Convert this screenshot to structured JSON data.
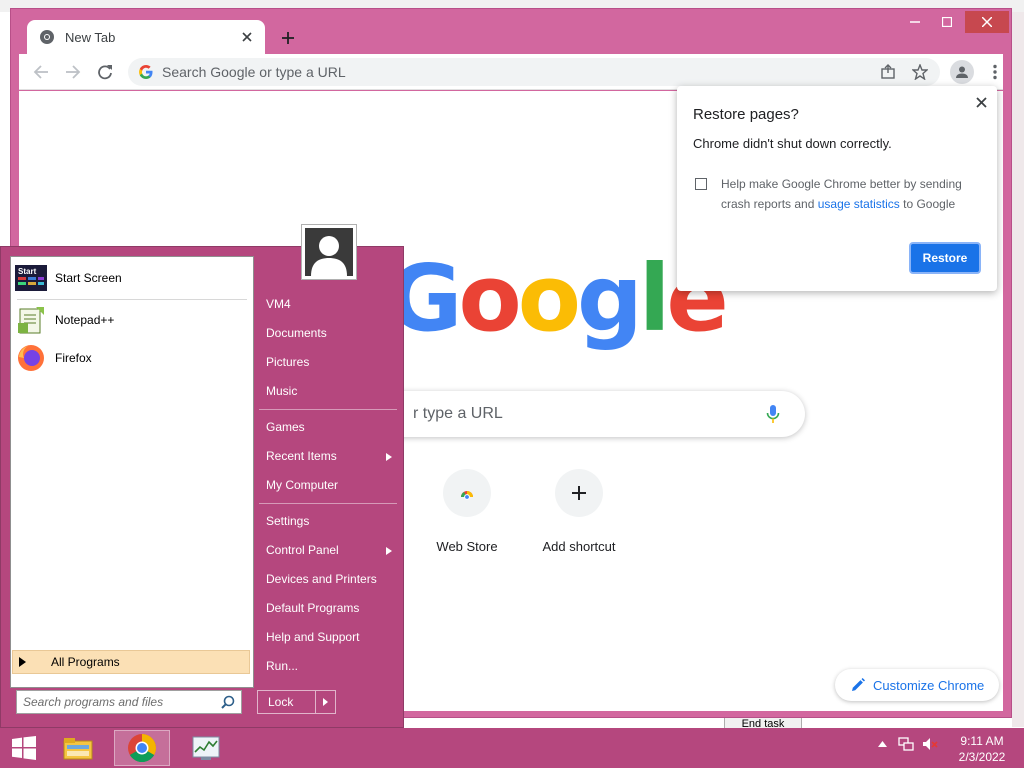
{
  "browser": {
    "tab": {
      "title": "New Tab"
    },
    "omnibox": {
      "placeholder": "Search Google or type a URL"
    },
    "ntp": {
      "logo_letters": [
        "G",
        "o",
        "o",
        "g",
        "l",
        "e"
      ],
      "logo_colors": [
        "#4285f4",
        "#ea4335",
        "#fbbc05",
        "#4285f4",
        "#34a853",
        "#ea4335"
      ],
      "search_text": "r type a URL",
      "shortcuts": [
        {
          "label": "Web Store",
          "icon": "chrome-web-store-icon"
        },
        {
          "label": "Add shortcut",
          "icon": "plus-icon"
        }
      ],
      "customize_label": "Customize Chrome"
    },
    "restore_popup": {
      "title": "Restore pages?",
      "message": "Chrome didn't shut down correctly.",
      "help_text": "Help make Google Chrome better by sending crash reports and",
      "link_text": "usage statistics",
      "help_suffix": "to Google",
      "button_label": "Restore"
    }
  },
  "start_menu": {
    "pinned": [
      {
        "label": "Start Screen",
        "icon": "start-screen-icon",
        "icon_text": "Start"
      },
      {
        "label": "Notepad++",
        "icon": "notepad-plus-plus-icon"
      },
      {
        "label": "Firefox",
        "icon": "firefox-icon"
      }
    ],
    "all_programs": "All Programs",
    "search_placeholder": "Search programs and files",
    "right_items": [
      "VM4",
      "Documents",
      "Pictures",
      "Music",
      "Games",
      "Recent Items",
      "My Computer",
      "Settings",
      "Control Panel",
      "Devices and Printers",
      "Default Programs",
      "Help and Support",
      "Run..."
    ],
    "lock_label": "Lock"
  },
  "taskbar": {
    "apps": [
      "file-explorer-icon",
      "chrome-icon",
      "task-manager-icon"
    ],
    "clock_time": "9:11 AM",
    "clock_date": "2/3/2022"
  },
  "background": {
    "end_task_label": "End task"
  },
  "colors": {
    "accent_pink": "#d2679f",
    "start_menu_bg": "#b5477e",
    "chrome_blue": "#1a73e8"
  }
}
